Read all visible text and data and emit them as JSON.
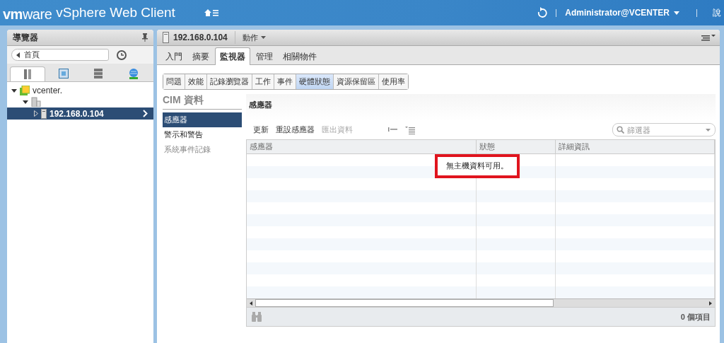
{
  "header": {
    "brand_vm": "vm",
    "brand_ware": "ware",
    "product": "vSphere Web Client",
    "user": "Administrator@VCENTER",
    "help": "說"
  },
  "navigator": {
    "title": "導覽器",
    "back": "首頁",
    "tabs": [
      {
        "selected": true
      },
      {
        "selected": false
      },
      {
        "selected": false
      },
      {
        "selected": false
      }
    ],
    "tree": [
      {
        "label": "vcenter.",
        "kind": "vcenter",
        "expanded": true,
        "selected": false,
        "children": [
          {
            "kind": "datacenter",
            "expanded": true,
            "selected": false,
            "children": [
              {
                "label": "192.168.0.104",
                "kind": "host",
                "expanded": false,
                "selected": true
              }
            ]
          }
        ]
      }
    ]
  },
  "object": {
    "title": "192.168.0.104",
    "actions": "動作",
    "tabs": [
      {
        "label": "入門",
        "selected": false
      },
      {
        "label": "摘要",
        "selected": false
      },
      {
        "label": "監視器",
        "selected": true
      },
      {
        "label": "管理",
        "selected": false
      },
      {
        "label": "相關物件",
        "selected": false
      }
    ],
    "subtabs": [
      {
        "label": "問題",
        "selected": false
      },
      {
        "label": "效能",
        "selected": false
      },
      {
        "label": "記錄瀏覽器",
        "selected": false
      },
      {
        "label": "工作",
        "selected": false
      },
      {
        "label": "事件",
        "selected": false
      },
      {
        "label": "硬體狀態",
        "selected": true
      },
      {
        "label": "資源保留區",
        "selected": false
      },
      {
        "label": "使用率",
        "selected": false
      }
    ]
  },
  "cim": {
    "title": "CIM 資料",
    "items": [
      {
        "label": "感應器",
        "selected": true,
        "disabled": false
      },
      {
        "label": "警示和警告",
        "selected": false,
        "disabled": false
      },
      {
        "label": "系統事件記錄",
        "selected": false,
        "disabled": true
      }
    ]
  },
  "sensors": {
    "title": "感應器",
    "toolbar": [
      {
        "label": "更新",
        "disabled": false
      },
      {
        "label": "重設感應器",
        "disabled": false
      },
      {
        "label": "匯出資料",
        "disabled": true
      }
    ],
    "filter": {
      "placeholder": "篩選器"
    },
    "table": {
      "columns": [
        "感應器",
        "狀態",
        "詳細資訊"
      ],
      "empty_message": "無主機資料可用。"
    },
    "count": "0 個項目"
  }
}
